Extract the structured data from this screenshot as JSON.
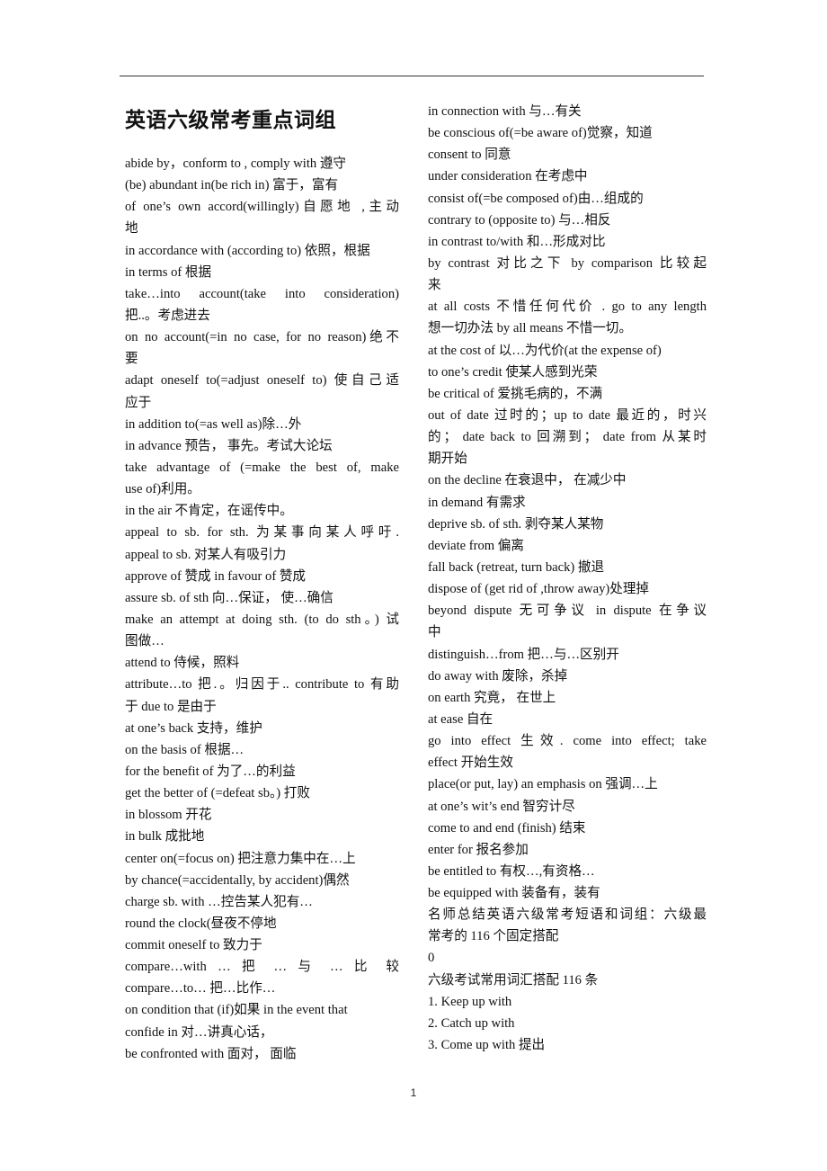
{
  "document": {
    "title": "英语六级常考重点词组",
    "left_column": [
      "abide by，conform to , comply with  遵守",
      "(be) abundant in(be rich in)  富于，富有",
      "of one’s own accord(willingly)自愿地  ,主动",
      "地",
      "in accordance with (according to)  依照，根据",
      "in terms of  根据",
      "take…into  account(take  into  consideration)",
      "把..。考虑进去",
      "on no account(=in no case, for no reason)绝不",
      "要",
      "adapt oneself to(=adjust oneself to)  使自己适",
      "应于",
      "in addition to(=as well as)除…外",
      "in advance  预告，  事先。考试大论坛",
      "take advantage of (=make the best of, make",
      "use of)利用。",
      "in the air 不肯定，在谣传中。",
      "appeal to sb. for sth. 为某事向某人呼吁.",
      "appeal to sb.  对某人有吸引力",
      "approve of 赞成  in favour of  赞成",
      "assure sb. of sth 向…保证，  使…确信",
      "make an attempt at doing sth. (to do sth。)  试",
      "图做…",
      "attend to 侍候，照料",
      "attribute…to 把.。归因于.. contribute to  有助",
      "于  due to  是由于",
      "at one’s back 支持，维护",
      "on the basis of  根据…",
      "for the benefit of  为了…的利益",
      "get the better of (=defeat sb。)  打败",
      "in blossom 开花",
      "in bulk  成批地",
      "center on(=focus on)  把注意力集中在…上",
      "by chance(=accidentally, by accident)偶然",
      "charge sb. with …控告某人犯有…",
      "round the clock(昼夜不停地",
      "commit oneself to  致力于",
      "compare…with  …  把  …  与  …  比  较",
      "compare…to…  把…比作…",
      "on condition that (if)如果  in the event that",
      "confide in  对…讲真心话，",
      "be confronted with  面对，  面临"
    ],
    "right_column": [
      "in connection with 与…有关",
      "be conscious of(=be aware of)觉察，知道",
      "consent to 同意",
      "under consideration  在考虑中",
      "consist of(=be composed of)由…组成的",
      "contrary to (opposite to)  与…相反",
      "in contrast to/with  和…形成对比",
      "by contrast  对比之下  by comparison  比较起",
      "来",
      "at all costs 不惜任何代价  . go to any length",
      "想一切办法  by all means 不惜一切。",
      "at the cost of  以…为代价(at the expense of)",
      "to one’s credit 使某人感到光荣",
      "be critical of  爱挑毛病的，不满",
      "out of date 过时的；up to date 最近的，时兴",
      "的；  date back to 回溯到；  date from 从某时",
      "期开始",
      "on the decline  在衰退中，  在减少中",
      "in demand 有需求",
      "deprive sb. of sth.  剥夺某人某物",
      "deviate from  偏离",
      "fall back (retreat, turn back)  撤退",
      "dispose of (get rid of ,throw away)处理掉",
      "beyond dispute  无可争议  in dispute  在争议",
      "中",
      "distinguish…from  把…与…区别开",
      "do away with 废除，杀掉",
      "on earth  究竟，  在世上",
      "at ease 自在",
      "go  into  effect  生效. come  into  effect;  take",
      "effect  开始生效",
      "place(or put, lay) an emphasis on  强调…上",
      "at one’s wit’s end  智穷计尽",
      "come to and end (finish)  结束",
      "enter for  报名参加",
      "be entitled to 有权…,有资格…",
      "be equipped with  装备有，装有",
      "名师总结英语六级常考短语和词组：六级最",
      "常考的 116 个固定搭配",
      "0",
      "六级考试常用词汇搭配 116 条",
      "1. Keep up with",
      "2. Catch up with",
      "3. Come up with  提出"
    ],
    "page_number": "1"
  },
  "justified_lines": {
    "left": [
      2,
      6,
      8,
      10,
      14,
      17,
      21,
      24,
      37
    ],
    "right": [
      7,
      9,
      14,
      15,
      23,
      29,
      37
    ]
  }
}
